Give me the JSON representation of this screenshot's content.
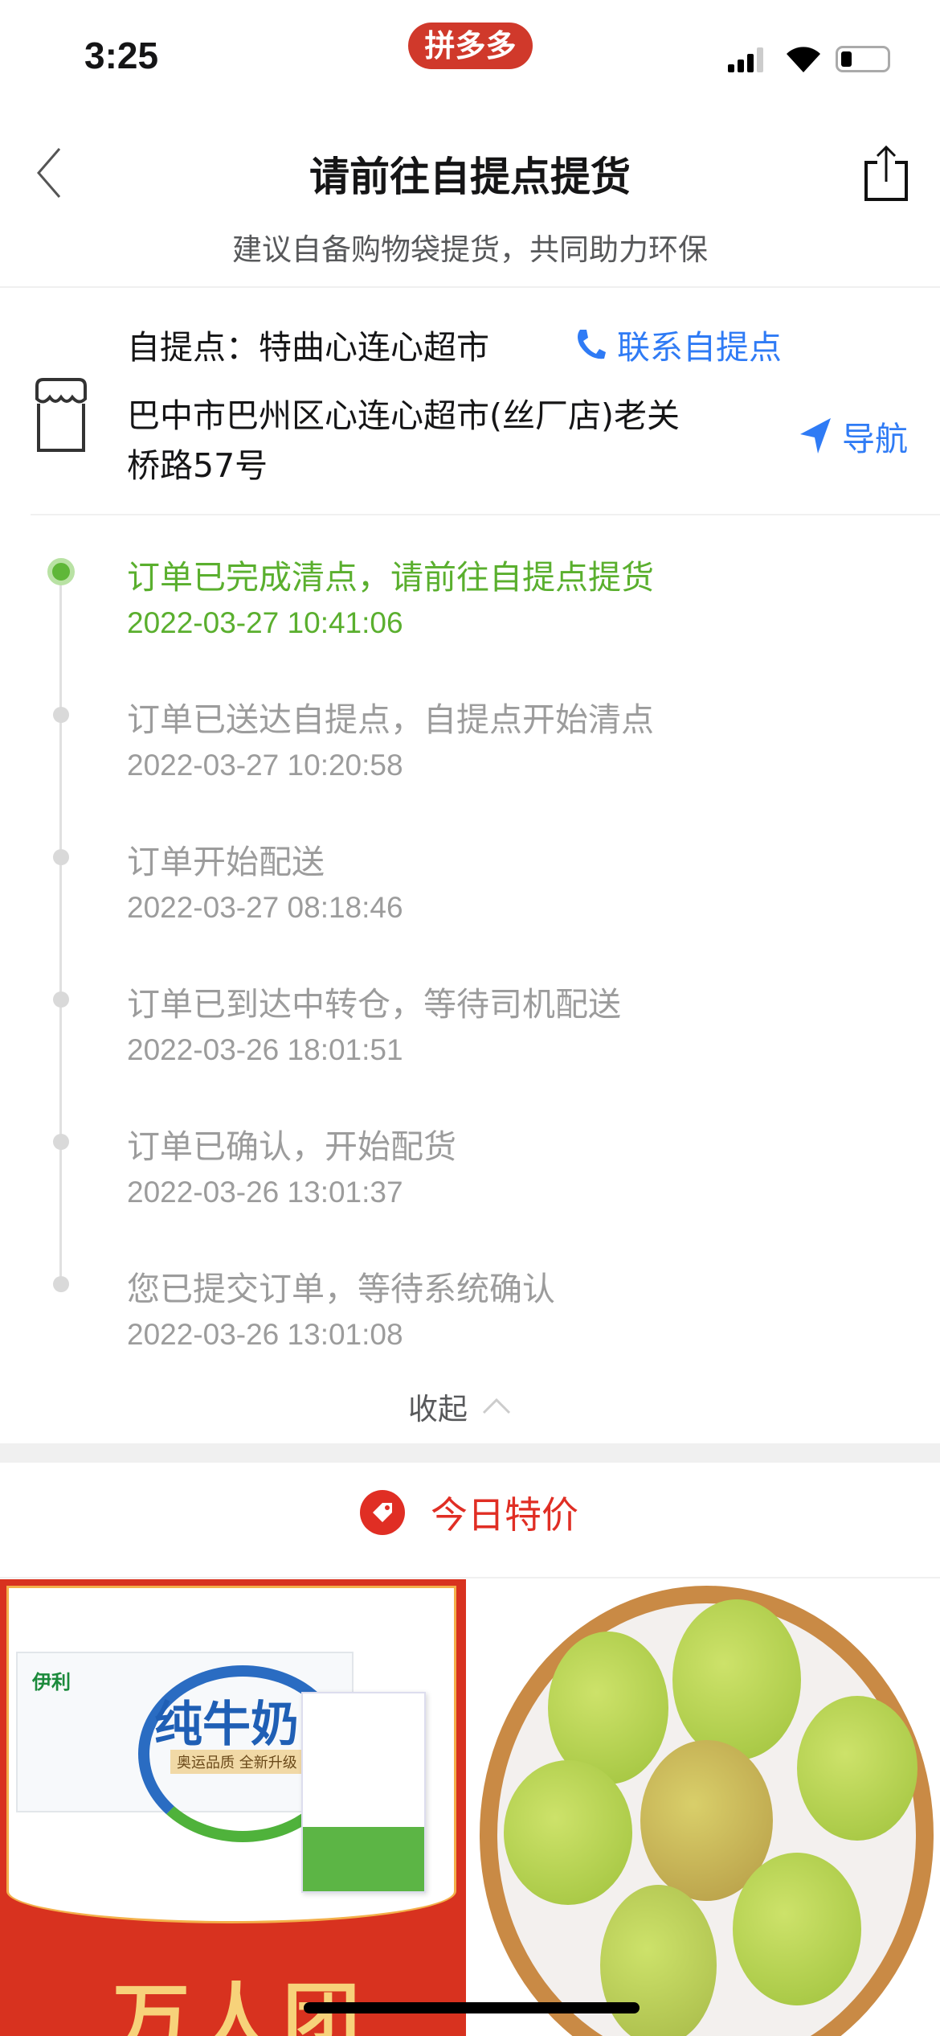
{
  "status_bar": {
    "time": "3:25",
    "app_badge": "拼多多",
    "icons": [
      "signal-icon",
      "wifi-icon",
      "battery-icon"
    ]
  },
  "nav": {
    "title": "请前往自提点提货",
    "subtitle": "建议自备购物袋提货，共同助力环保",
    "back_icon": "chevron-left-icon",
    "share_icon": "share-icon"
  },
  "pickup": {
    "label": "自提点：特曲心连心超市",
    "contact": "联系自提点",
    "address_line1": "巴中市巴州区心连心超市(丝厂店)老关",
    "address_line2": "桥路57号",
    "navigate": "导航"
  },
  "timeline": [
    {
      "title": "订单已完成清点，请前往自提点提货",
      "time": "2022-03-27 10:41:06",
      "active": true
    },
    {
      "title": "订单已送达自提点，自提点开始清点",
      "time": "2022-03-27 10:20:58"
    },
    {
      "title": "订单开始配送",
      "time": "2022-03-27 08:18:46"
    },
    {
      "title": "订单已到达中转仓，等待司机配送",
      "time": "2022-03-26 18:01:51"
    },
    {
      "title": "订单已确认，开始配货",
      "time": "2022-03-26 13:01:37"
    },
    {
      "title": "您已提交订单，等待系统确认",
      "time": "2022-03-26 13:01:08"
    }
  ],
  "collapse_label": "收起",
  "deals": {
    "title": "今日特价",
    "products": [
      {
        "brand": "伊利",
        "name": "纯牛奶",
        "tag": "奥运品质 全新升级",
        "banner": "万人团"
      },
      {
        "name": "pears"
      }
    ]
  },
  "colors": {
    "accent_red": "#e02e24",
    "active_green": "#5aaf2e",
    "link_blue": "#2f7bf5"
  }
}
